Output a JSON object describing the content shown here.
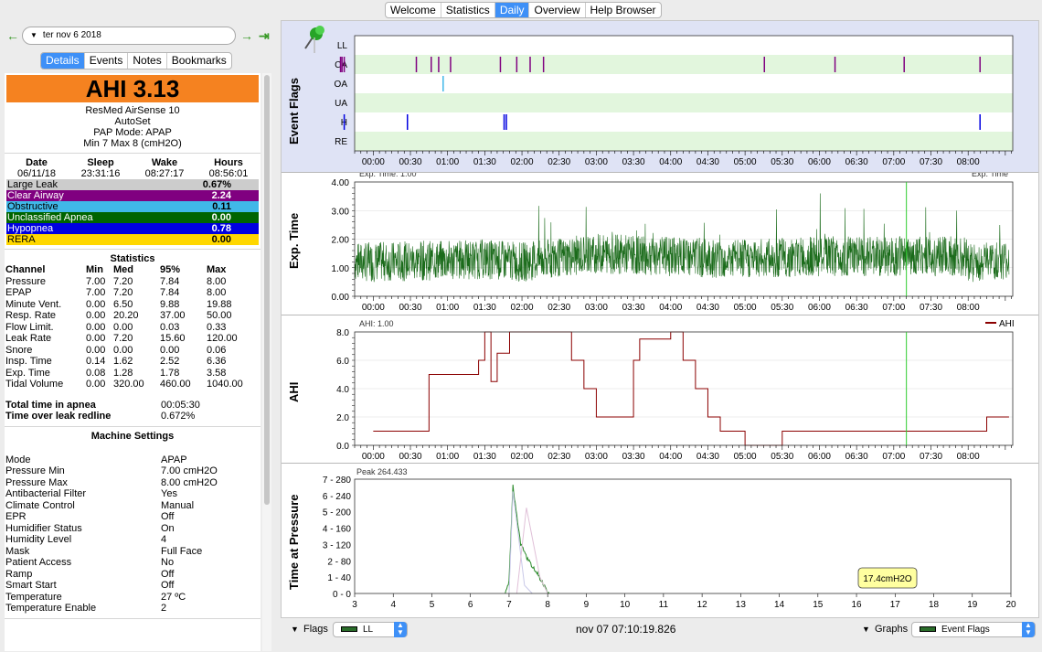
{
  "top_tabs": [
    "Welcome",
    "Statistics",
    "Daily",
    "Overview",
    "Help Browser"
  ],
  "active_top_tab": "Daily",
  "date_selector": {
    "value": "ter nov 6 2018",
    "back_icon": "arrow-left-icon",
    "forward_icon": "arrow-right-icon",
    "end_icon": "jump-end-icon"
  },
  "left_tabs": [
    "Details",
    "Events",
    "Notes",
    "Bookmarks"
  ],
  "active_left_tab": "Details",
  "ahi_label": "AHI 3.13",
  "device": {
    "name": "ResMed AirSense 10",
    "model": "AutoSet",
    "mode": "PAP Mode: APAP",
    "pressure": "Min 7 Max 8 (cmH2O)"
  },
  "session": {
    "headers": [
      "Date",
      "Sleep",
      "Wake",
      "Hours"
    ],
    "values": [
      "06/11/18",
      "23:31:16",
      "08:27:17",
      "08:56:01"
    ]
  },
  "event_rates": [
    {
      "label": "Large Leak",
      "value": "0.67%",
      "color": "#cccccc",
      "text": "#000000"
    },
    {
      "label": "Clear Airway",
      "value": "2.24",
      "color": "#800080",
      "text": "#ffffff"
    },
    {
      "label": "Obstructive",
      "value": "0.11",
      "color": "#40b8e8",
      "text": "#000000"
    },
    {
      "label": "Unclassified Apnea",
      "value": "0.00",
      "color": "#006400",
      "text": "#ffffff"
    },
    {
      "label": "Hypopnea",
      "value": "0.78",
      "color": "#0000e0",
      "text": "#ffffff"
    },
    {
      "label": "RERA",
      "value": "0.00",
      "color": "#ffd700",
      "text": "#000000"
    }
  ],
  "statistics": {
    "title": "Statistics",
    "headers": [
      "Channel",
      "Min",
      "Med",
      "95%",
      "Max"
    ],
    "rows": [
      [
        "Pressure",
        "7.00",
        "7.20",
        "7.84",
        "8.00"
      ],
      [
        "EPAP",
        "7.00",
        "7.20",
        "7.84",
        "8.00"
      ],
      [
        "Minute Vent.",
        "0.00",
        "6.50",
        "9.88",
        "19.88"
      ],
      [
        "Resp. Rate",
        "0.00",
        "20.20",
        "37.00",
        "50.00"
      ],
      [
        "Flow Limit.",
        "0.00",
        "0.00",
        "0.03",
        "0.33"
      ],
      [
        "Leak Rate",
        "0.00",
        "7.20",
        "15.60",
        "120.00"
      ],
      [
        "Snore",
        "0.00",
        "0.00",
        "0.00",
        "0.06"
      ],
      [
        "Insp. Time",
        "0.14",
        "1.62",
        "2.52",
        "6.36"
      ],
      [
        "Exp. Time",
        "0.08",
        "1.28",
        "1.78",
        "3.58"
      ],
      [
        "Tidal Volume",
        "0.00",
        "320.00",
        "460.00",
        "1040.00"
      ]
    ]
  },
  "apnea_summary": [
    {
      "label": "Total time in apnea",
      "value": "00:05:30"
    },
    {
      "label": "Time over leak redline",
      "value": "0.672%"
    }
  ],
  "machine_settings": {
    "title": "Machine Settings",
    "rows": [
      [
        "Mode",
        "APAP"
      ],
      [
        "Pressure Min",
        "7.00 cmH2O"
      ],
      [
        "Pressure Max",
        "8.00 cmH2O"
      ],
      [
        "Antibacterial Filter",
        "Yes"
      ],
      [
        "Climate Control",
        "Manual"
      ],
      [
        "EPR",
        "Off"
      ],
      [
        "Humidifier Status",
        "On"
      ],
      [
        "Humidity Level",
        "4"
      ],
      [
        "Mask",
        "Full Face"
      ],
      [
        "Patient Access",
        "No"
      ],
      [
        "Ramp",
        "Off"
      ],
      [
        "Smart Start",
        "Off"
      ],
      [
        "Temperature",
        "27 ºC"
      ],
      [
        "Temperature Enable",
        "2"
      ]
    ]
  },
  "time_ticks": [
    "00:00",
    "00:30",
    "01:00",
    "01:30",
    "02:00",
    "02:30",
    "03:00",
    "03:30",
    "04:00",
    "04:30",
    "05:00",
    "05:30",
    "06:00",
    "06:30",
    "07:00",
    "07:30",
    "08:00"
  ],
  "graphs": {
    "event_flags": {
      "ylabel": "Event Flags",
      "rows": [
        "LL",
        "CA",
        "OA",
        "UA",
        "H",
        "RE"
      ],
      "pin_icon": "pushpin-icon",
      "flags": {
        "LL": {
          "color": "#bbbbbb",
          "times_hours": [
            -0.45
          ]
        },
        "CA": {
          "color": "#800080",
          "times_hours": [
            -0.1,
            -0.08,
            -0.05,
            0.92,
            1.12,
            1.22,
            1.38,
            2.05,
            2.27,
            2.45,
            2.63,
            5.6,
            6.55,
            7.48,
            8.5
          ]
        },
        "OA": {
          "color": "#40b8e8",
          "times_hours": [
            1.28
          ]
        },
        "UA": {
          "color": "#006400",
          "times_hours": []
        },
        "H": {
          "color": "#0000e0",
          "times_hours": [
            -1.0,
            -0.05,
            0.8,
            2.1,
            2.13,
            8.5
          ]
        },
        "RE": {
          "color": "#ffd700",
          "times_hours": []
        }
      }
    },
    "exp_time": {
      "ylabel": "Exp. Time",
      "overlay_left": "Exp. Time: 1.00",
      "overlay_right": "Exp. Time",
      "yticks": [
        "4.00",
        "3.00",
        "2.00",
        "1.00",
        "0.00"
      ],
      "ylim": [
        0,
        4
      ],
      "color": "#1a6b1a"
    },
    "ahi": {
      "ylabel": "AHI",
      "overlay_left": "AHI: 1.00",
      "legend": "AHI",
      "yticks": [
        "8.0",
        "6.0",
        "4.0",
        "2.0",
        "0.0"
      ],
      "ylim": [
        0,
        8
      ],
      "color": "#8b0000"
    },
    "time_at_pressure": {
      "ylabel": "Time at Pressure",
      "peak": "Peak 264.433",
      "tooltip": "17.4cmH2O",
      "yticks": [
        "7 - 280",
        "6 - 240",
        "5 - 200",
        "4 - 160",
        "3 - 120",
        "2 - 80",
        "1 - 40",
        "0 - 0"
      ],
      "xticks": [
        "3",
        "4",
        "5",
        "6",
        "7",
        "8",
        "9",
        "10",
        "11",
        "12",
        "13",
        "14",
        "15",
        "16",
        "17",
        "18",
        "19",
        "20"
      ]
    }
  },
  "cursor_time_hours": 7.17,
  "bottom_bar": {
    "flags_label": "Flags",
    "flags_select": "LL",
    "timestamp": "nov 07 07:10:19.826",
    "graphs_label": "Graphs",
    "graphs_select": "Event Flags"
  },
  "chart_data": [
    {
      "type": "line",
      "title": "",
      "ylabel": "AHI",
      "xlabel": "",
      "series": [
        {
          "name": "AHI",
          "x": [
            "00:00",
            "00:30",
            "00:45",
            "01:00",
            "01:15",
            "01:25",
            "01:30",
            "01:35",
            "01:40",
            "01:50",
            "02:00",
            "02:30",
            "02:40",
            "02:50",
            "03:00",
            "03:15",
            "03:30",
            "03:35",
            "04:00",
            "04:10",
            "04:20",
            "04:30",
            "04:40",
            "05:00",
            "05:30",
            "06:00",
            "06:30",
            "07:00",
            "07:30",
            "08:00",
            "08:15"
          ],
          "values": [
            1.0,
            1.0,
            5.0,
            5.0,
            5.0,
            6.0,
            8.0,
            4.5,
            6.5,
            8.0,
            8.0,
            8.0,
            6.0,
            4.0,
            2.0,
            2.0,
            6.0,
            7.5,
            8.0,
            6.0,
            4.0,
            2.0,
            1.0,
            0.0,
            1.0,
            1.0,
            1.0,
            1.0,
            1.0,
            1.0,
            2.0
          ]
        }
      ],
      "ylim": [
        0,
        8
      ]
    },
    {
      "type": "line",
      "title": "",
      "ylabel": "Exp. Time",
      "xlabel": "",
      "series": [
        {
          "name": "Exp. Time",
          "x": [
            "00:00",
            "01:30",
            "02:00",
            "03:00",
            "04:00",
            "05:00",
            "06:00",
            "07:00",
            "08:00"
          ],
          "values": [
            1.2,
            1.3,
            1.2,
            1.5,
            1.4,
            1.3,
            1.4,
            1.4,
            1.4
          ]
        }
      ],
      "ylim": [
        0,
        4
      ]
    },
    {
      "type": "line",
      "title": "",
      "ylabel": "Time at Pressure",
      "xlabel": "",
      "series": [
        {
          "x": [
            6.9,
            7.0,
            7.1,
            7.3,
            7.5,
            7.7,
            7.9,
            8.0
          ],
          "values": [
            0,
            30,
            264,
            120,
            80,
            55,
            20,
            0
          ]
        }
      ],
      "ylim": [
        0,
        280
      ],
      "xlim": [
        3,
        20
      ]
    }
  ]
}
